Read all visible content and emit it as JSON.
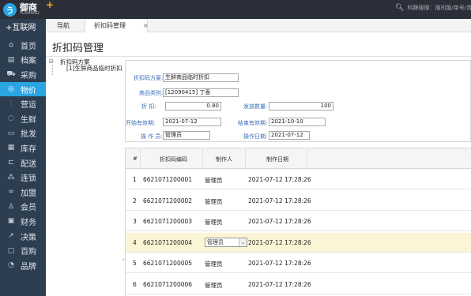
{
  "app": {
    "logo_letter": "う",
    "logo_name": "御商",
    "logo_sub": "YUSHANG",
    "logo_plus": "+",
    "search_icon": "search-icon",
    "search_text": "科静搜搜：搜司能/单号/青"
  },
  "sidebar": {
    "header": "+互联网",
    "items": [
      {
        "label": "首页",
        "icon": "⌂"
      },
      {
        "label": "档案",
        "icon": "▤"
      },
      {
        "label": "采购",
        "icon": "⛟"
      },
      {
        "label": "物价",
        "icon": "◎"
      },
      {
        "label": "营运",
        "icon": "⫶"
      },
      {
        "label": "生鲜",
        "icon": "◌"
      },
      {
        "label": "批发",
        "icon": "▭"
      },
      {
        "label": "库存",
        "icon": "▦"
      },
      {
        "label": "配送",
        "icon": "⊏"
      },
      {
        "label": "连锁",
        "icon": "⁂"
      },
      {
        "label": "加盟",
        "icon": "∞"
      },
      {
        "label": "会员",
        "icon": "♙"
      },
      {
        "label": "财务",
        "icon": "▣"
      },
      {
        "label": "决策",
        "icon": "↗"
      },
      {
        "label": "百购",
        "icon": "▢"
      },
      {
        "label": "品牌",
        "icon": "◔"
      }
    ],
    "active_index": 3
  },
  "tabs": {
    "nav_label": "导航",
    "active_label": "折扣码管理",
    "close_glyph": "×"
  },
  "page": {
    "title": "折扣码管理"
  },
  "tree": {
    "toggle": "⊟",
    "root": "折扣码方案",
    "child": "[1]生鲜商品临时折扣"
  },
  "form": {
    "scheme_label": "折扣码方案:",
    "scheme_value": "生鲜商品临时折扣",
    "product_label": "商品类别:",
    "product_value": "[12090415] 丁香",
    "discount_label": "折    扣:",
    "discount_value": "0.80",
    "qty_label": "发放数量:",
    "qty_value": "100",
    "start_label": "开始有效期:",
    "start_value": "2021-07-12",
    "end_label": "结束有效期:",
    "end_value": "2021-10-10",
    "operator_label": "操 作 员:",
    "operator_value": "管理员",
    "opdate_label": "操作日期:",
    "opdate_value": "2021-07-12"
  },
  "grid": {
    "headers": [
      "#",
      "折扣码编码",
      "制作人",
      "制作日期"
    ],
    "rows": [
      {
        "no": "1",
        "code": "6621071200001",
        "maker": "管理员",
        "date": "2021-07-12 17:28:26"
      },
      {
        "no": "2",
        "code": "6621071200002",
        "maker": "管理员",
        "date": "2021-07-12 17:28:26"
      },
      {
        "no": "3",
        "code": "6621071200003",
        "maker": "管理员",
        "date": "2021-07-12 17:28:26"
      },
      {
        "no": "4",
        "code": "6621071200004",
        "maker": "管理员",
        "date": "2021-07-12 17:28:26"
      },
      {
        "no": "5",
        "code": "6621071200005",
        "maker": "管理员",
        "date": "2021-07-12 17:28:26"
      },
      {
        "no": "6",
        "code": "6621071200006",
        "maker": "管理员",
        "date": "2021-07-12 17:28:26"
      }
    ],
    "selected_index": 3,
    "combo_arrow": "⌄",
    "side_marker": "‹"
  },
  "colors": {
    "topbar": "#2b2f3a",
    "sidebar": "#2c3e50",
    "accent": "#29a5e4",
    "label_blue": "#3b6fb6",
    "row_selected": "#fcf5d5"
  }
}
